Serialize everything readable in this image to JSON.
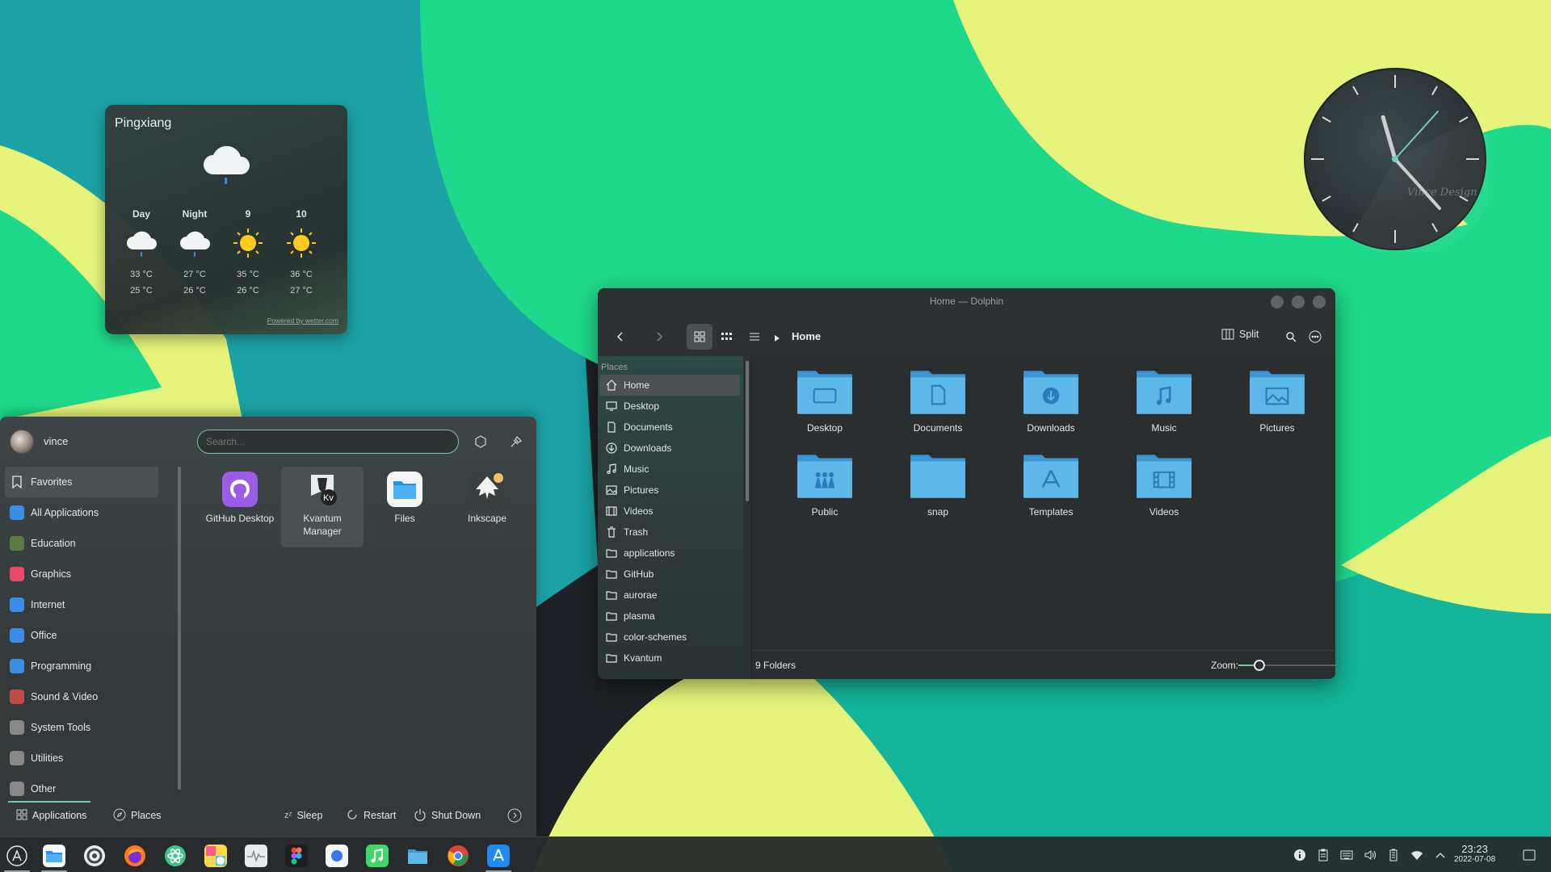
{
  "weather": {
    "city": "Pingxiang",
    "icon": "cloud-rain-icon",
    "days": [
      {
        "label": "Day",
        "icon": "cloud-rain-icon",
        "high": "33 °C",
        "low": "25 °C"
      },
      {
        "label": "Night",
        "icon": "cloud-rain-icon",
        "high": "27 °C",
        "low": "26 °C"
      },
      {
        "label": "9",
        "icon": "sun-icon",
        "high": "35 °C",
        "low": "26 °C"
      },
      {
        "label": "10",
        "icon": "sun-icon",
        "high": "36 °C",
        "low": "27 °C"
      }
    ],
    "credit": "Powered by wetter.com"
  },
  "clock": {
    "brand": "Vince Design",
    "time": "23:23"
  },
  "launcher": {
    "user": "vince",
    "search_placeholder": "Search...",
    "categories": [
      {
        "label": "Favorites",
        "icon": "bookmark-icon"
      },
      {
        "label": "All Applications",
        "icon": "grid-icon"
      },
      {
        "label": "Education",
        "icon": "education-icon"
      },
      {
        "label": "Graphics",
        "icon": "graphics-icon"
      },
      {
        "label": "Internet",
        "icon": "internet-icon"
      },
      {
        "label": "Office",
        "icon": "office-icon"
      },
      {
        "label": "Programming",
        "icon": "programming-icon"
      },
      {
        "label": "Sound & Video",
        "icon": "multimedia-icon"
      },
      {
        "label": "System Tools",
        "icon": "system-icon"
      },
      {
        "label": "Utilities",
        "icon": "utilities-icon"
      },
      {
        "label": "Other",
        "icon": "other-icon"
      }
    ],
    "apps": [
      {
        "label": "GitHub Desktop",
        "icon": "github-icon"
      },
      {
        "label": "Kvantum Manager",
        "icon": "kvantum-icon"
      },
      {
        "label": "Files",
        "icon": "files-icon"
      },
      {
        "label": "Inkscape",
        "icon": "inkscape-icon"
      }
    ],
    "footer": {
      "tab_apps": "Applications",
      "tab_places": "Places",
      "sleep": "Sleep",
      "restart": "Restart",
      "shutdown": "Shut Down"
    }
  },
  "dolphin": {
    "title": "Home — Dolphin",
    "breadcrumb": "Home",
    "split_label": "Split",
    "places_header": "Places",
    "places": [
      {
        "label": "Home",
        "icon": "home-icon"
      },
      {
        "label": "Desktop",
        "icon": "desktop-icon"
      },
      {
        "label": "Documents",
        "icon": "documents-icon"
      },
      {
        "label": "Downloads",
        "icon": "downloads-icon"
      },
      {
        "label": "Music",
        "icon": "music-icon"
      },
      {
        "label": "Pictures",
        "icon": "pictures-icon"
      },
      {
        "label": "Videos",
        "icon": "videos-icon"
      },
      {
        "label": "Trash",
        "icon": "trash-icon"
      },
      {
        "label": "applications",
        "icon": "folder-icon"
      },
      {
        "label": "GitHub",
        "icon": "folder-icon"
      },
      {
        "label": "aurorae",
        "icon": "folder-icon"
      },
      {
        "label": "plasma",
        "icon": "folder-icon"
      },
      {
        "label": "color-schemes",
        "icon": "folder-icon"
      },
      {
        "label": "Kvantum",
        "icon": "folder-icon"
      }
    ],
    "folders": [
      {
        "label": "Desktop",
        "emblem": "desktop"
      },
      {
        "label": "Documents",
        "emblem": "document"
      },
      {
        "label": "Downloads",
        "emblem": "download"
      },
      {
        "label": "Music",
        "emblem": "music"
      },
      {
        "label": "Pictures",
        "emblem": "picture"
      },
      {
        "label": "Public",
        "emblem": "public"
      },
      {
        "label": "snap",
        "emblem": "none"
      },
      {
        "label": "Templates",
        "emblem": "template"
      },
      {
        "label": "Videos",
        "emblem": "video"
      }
    ],
    "status": "9 Folders",
    "zoom_label": "Zoom:",
    "zoom_level": 0.22
  },
  "taskbar": {
    "apps": [
      {
        "name": "app-launcher-icon"
      },
      {
        "name": "files-icon"
      },
      {
        "name": "settings-icon"
      },
      {
        "name": "firefox-icon"
      },
      {
        "name": "atom-icon"
      },
      {
        "name": "photos-icon"
      },
      {
        "name": "monitor-icon"
      },
      {
        "name": "figma-icon"
      },
      {
        "name": "signal-icon"
      },
      {
        "name": "music-icon"
      },
      {
        "name": "folder-icon"
      },
      {
        "name": "chrome-icon"
      },
      {
        "name": "app-store-icon"
      }
    ],
    "tray": [
      {
        "name": "info-icon"
      },
      {
        "name": "clipboard-icon"
      },
      {
        "name": "keyboard-icon"
      },
      {
        "name": "volume-icon"
      },
      {
        "name": "battery-icon"
      },
      {
        "name": "wifi-icon"
      },
      {
        "name": "chevron-up-icon"
      }
    ],
    "time": "23:23",
    "date": "2022-07-08"
  },
  "colors": {
    "accent": "#7fc3a8",
    "folder": "#5db8e8",
    "wall_green": "#1edd8a",
    "wall_teal": "#1ba3a5",
    "wall_yellow": "#e7f57a"
  }
}
